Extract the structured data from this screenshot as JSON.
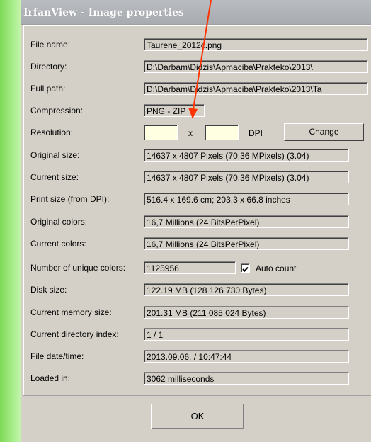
{
  "window": {
    "title": "IrfanView - Image properties"
  },
  "rows": [
    {
      "label": "File name:",
      "value": "Taurene_2012c.png"
    },
    {
      "label": "Directory:",
      "value": "D:\\Darbam\\Didzis\\Apmaciba\\Prakteko\\2013\\"
    },
    {
      "label": "Full path:",
      "value": "D:\\Darbam\\Didzis\\Apmaciba\\Prakteko\\2013\\Ta"
    },
    {
      "label": "Compression:",
      "value": "PNG - ZIP"
    },
    {
      "label": "Resolution:"
    },
    {
      "label": "Original size:",
      "value": "14637 x 4807  Pixels (70.36 MPixels) (3.04)"
    },
    {
      "label": "Current size:",
      "value": "14637 x 4807  Pixels (70.36 MPixels) (3.04)"
    },
    {
      "label": "Print size (from DPI):",
      "value": "516.4 x 169.6 cm; 203.3 x 66.8 inches"
    },
    {
      "label": "Original colors:",
      "value": "16,7 Millions   (24 BitsPerPixel)"
    },
    {
      "label": "Current colors:",
      "value": "16,7 Millions   (24 BitsPerPixel)"
    },
    {
      "label": "Number of unique colors:",
      "value": "1125956"
    },
    {
      "label": "Disk size:",
      "value": "122.19 MB (128 126 730 Bytes)"
    },
    {
      "label": "Current memory size:",
      "value": "201.31  MB (211 085 024 Bytes)"
    },
    {
      "label": "Current directory index:",
      "value": "1  /  1"
    },
    {
      "label": "File date/time:",
      "value": "2013.09.06. / 10:47:44"
    },
    {
      "label": "Loaded in:",
      "value": "3062 milliseconds"
    }
  ],
  "resolution": {
    "x_value": "",
    "y_value": "",
    "separator": "x",
    "unit": "DPI",
    "change_label": "Change"
  },
  "auto_count": {
    "label": "Auto count",
    "checked": true
  },
  "ok_label": "OK",
  "colors": {
    "annotation_arrow": "#ff3300",
    "side_strip": "#8ee26a"
  }
}
